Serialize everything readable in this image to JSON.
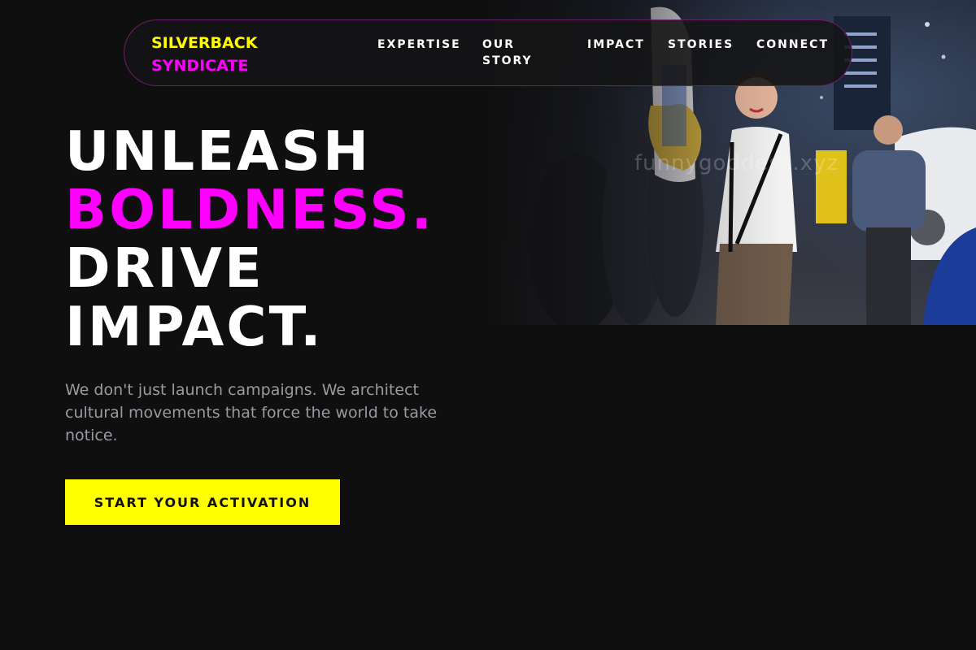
{
  "brand": {
    "line1": "SILVERBACK",
    "line2": "SYNDICATE",
    "color_primary": "#ffff00",
    "color_secondary": "#ff00ff"
  },
  "nav": {
    "items": [
      {
        "label": "EXPERTISE"
      },
      {
        "label": "OUR STORY"
      },
      {
        "label": "IMPACT"
      },
      {
        "label": "STORIES"
      },
      {
        "label": "CONNECT"
      }
    ]
  },
  "hero": {
    "headline": [
      "UNLEASH",
      "BOLDNESS.",
      "DRIVE",
      "IMPACT."
    ],
    "subtext": "We don't just launch campaigns. We architect cultural movements that force the world to take notice.",
    "cta_label": "START YOUR ACTIVATION",
    "image_watermark": "funnygoddess.xyz"
  },
  "colors": {
    "background": "#0f0f10",
    "accent_yellow": "#ffff00",
    "accent_magenta": "#ff00ff",
    "text_muted": "#9a9aa2"
  }
}
